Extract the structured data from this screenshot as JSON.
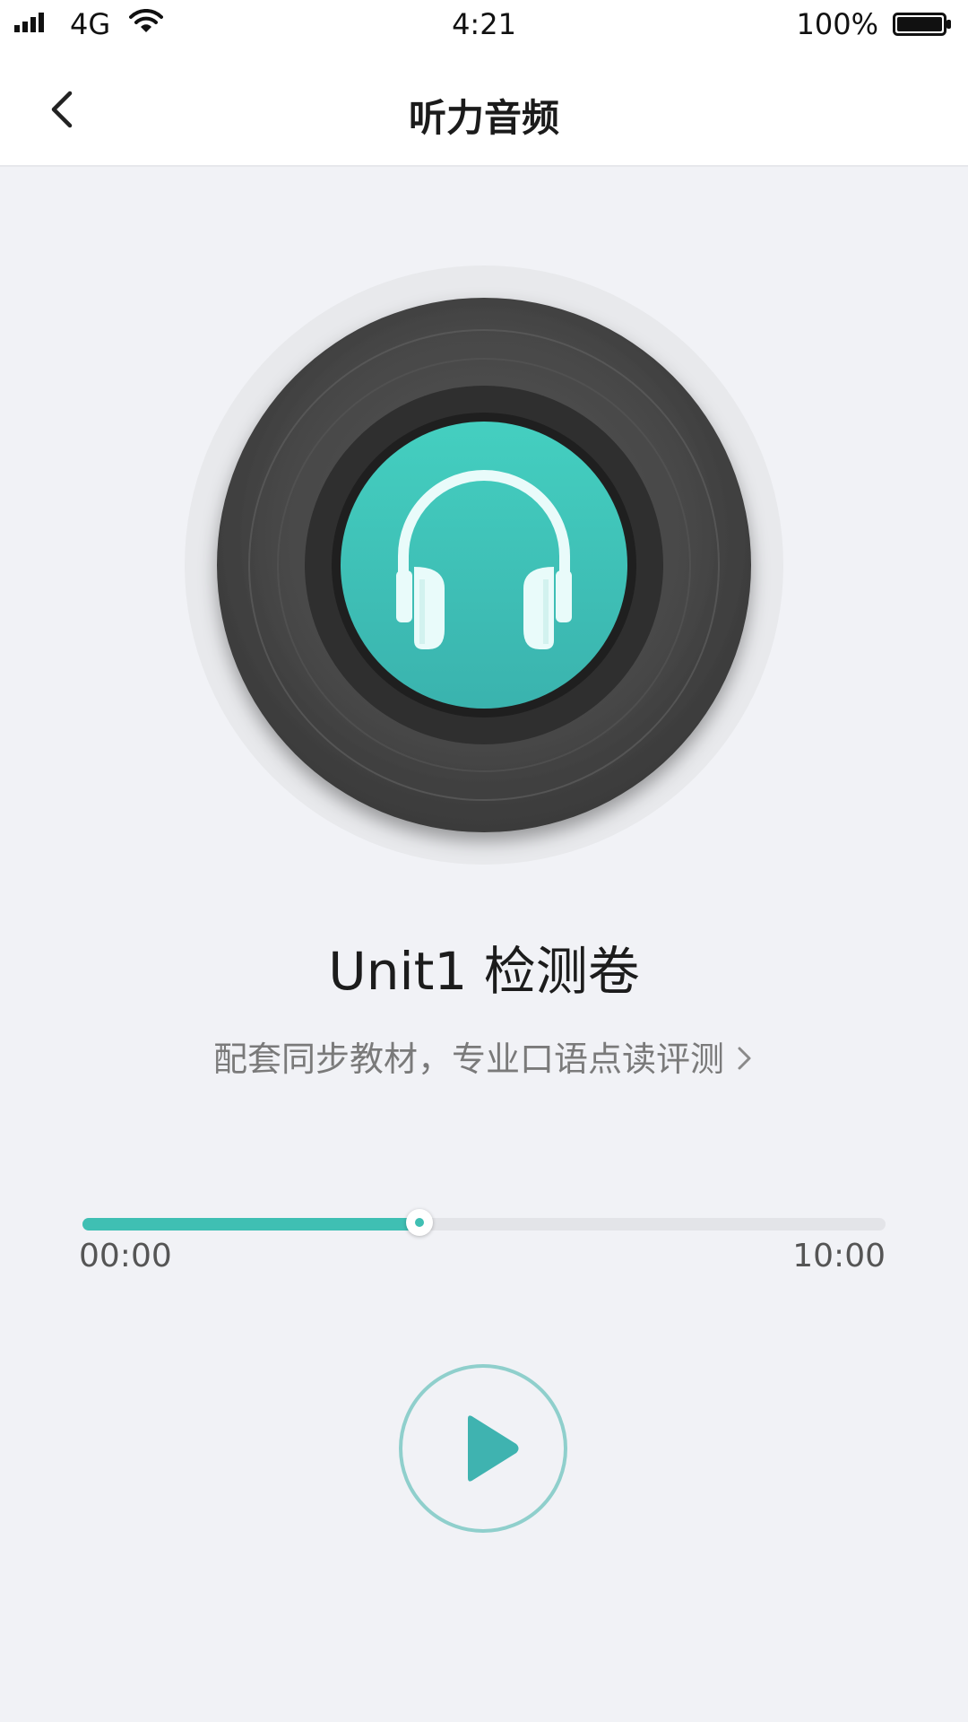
{
  "status_bar": {
    "network": "4G",
    "time": "4:21",
    "battery": "100%"
  },
  "nav": {
    "title": "听力音频"
  },
  "track": {
    "title": "Unit1 检测卷",
    "subtitle": "配套同步教材，专业口语点读评测"
  },
  "player": {
    "elapsed": "00:00",
    "total": "10:00",
    "progress_fraction": 0.42
  },
  "colors": {
    "accent": "#3fbfb3",
    "record_label": "#40c4b8",
    "background": "#f1f2f6"
  },
  "icons": {
    "back": "chevron-left-icon",
    "record": "vinyl-record-icon",
    "headphones": "headphones-icon",
    "play": "play-icon",
    "subtitle_arrow": "chevron-right-icon"
  }
}
